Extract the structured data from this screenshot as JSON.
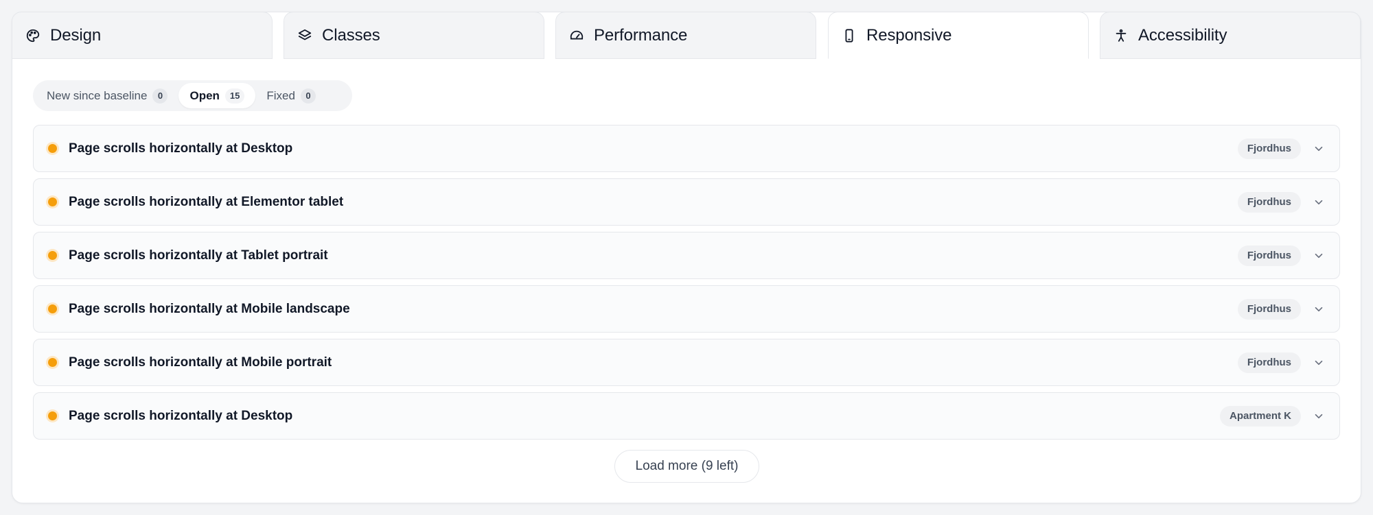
{
  "tabs": [
    {
      "label": "Design",
      "icon": "palette-icon"
    },
    {
      "label": "Classes",
      "icon": "layers-icon"
    },
    {
      "label": "Performance",
      "icon": "gauge-icon"
    },
    {
      "label": "Responsive",
      "icon": "smartphone-icon",
      "active": true
    },
    {
      "label": "Accessibility",
      "icon": "accessibility-icon"
    }
  ],
  "filters": [
    {
      "label": "New since baseline",
      "count": "0"
    },
    {
      "label": "Open",
      "count": "15",
      "active": true
    },
    {
      "label": "Fixed",
      "count": "0"
    }
  ],
  "issues": [
    {
      "title": "Page scrolls horizontally at Desktop",
      "tag": "Fjordhus"
    },
    {
      "title": "Page scrolls horizontally at Elementor tablet",
      "tag": "Fjordhus"
    },
    {
      "title": "Page scrolls horizontally at Tablet portrait",
      "tag": "Fjordhus"
    },
    {
      "title": "Page scrolls horizontally at Mobile landscape",
      "tag": "Fjordhus"
    },
    {
      "title": "Page scrolls horizontally at Mobile portrait",
      "tag": "Fjordhus"
    },
    {
      "title": "Page scrolls horizontally at Desktop",
      "tag": "Apartment K"
    }
  ],
  "load_more_label": "Load more (9 left)",
  "colors": {
    "severity_dot": "#f59e0b",
    "card_bg": "#ffffff",
    "page_bg": "#f3f4f6"
  }
}
